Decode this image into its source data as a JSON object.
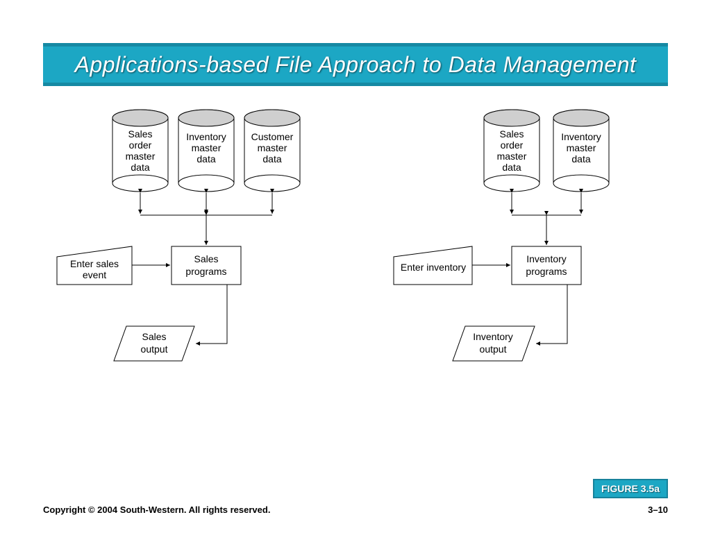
{
  "title": "Applications-based File Approach to Data Management",
  "figure_label": "FIGURE 3.5a",
  "copyright": "Copyright © 2004 South-Western. All rights reserved.",
  "page_number": "3–10",
  "diagram": {
    "left_group": {
      "cylinders": [
        {
          "lines": [
            "Sales",
            "order",
            "master",
            "data"
          ]
        },
        {
          "lines": [
            "Inventory",
            "master",
            "data"
          ]
        },
        {
          "lines": [
            "Customer",
            "master",
            "data"
          ]
        }
      ],
      "input": {
        "lines": [
          "Enter sales",
          "event"
        ]
      },
      "process": {
        "lines": [
          "Sales",
          "programs"
        ]
      },
      "output": {
        "lines": [
          "Sales",
          "output"
        ]
      }
    },
    "right_group": {
      "cylinders": [
        {
          "lines": [
            "Sales",
            "order",
            "master",
            "data"
          ]
        },
        {
          "lines": [
            "Inventory",
            "master",
            "data"
          ]
        }
      ],
      "input": {
        "lines": [
          "Enter inventory"
        ]
      },
      "process": {
        "lines": [
          "Inventory",
          "programs"
        ]
      },
      "output": {
        "lines": [
          "Inventory",
          "output"
        ]
      }
    }
  }
}
